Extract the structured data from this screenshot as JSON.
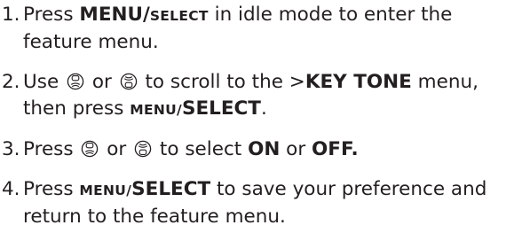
{
  "steps": [
    {
      "number": "1.",
      "t1": "Press ",
      "menu_bold": "MENU/",
      "select_sc": "SELECT",
      "t2": " in idle mode to enter the feature menu."
    },
    {
      "number": "2.",
      "t1": "Use ",
      "t2": " or ",
      "t3": " to scroll to the >",
      "key_tone": "KEY TONE",
      "t4": " menu, then press ",
      "menu_sc": "MENU/",
      "select_bold": "SELECT",
      "t5": "."
    },
    {
      "number": "3.",
      "t1": "Press ",
      "t2": " or ",
      "t3": " to select ",
      "on": "ON",
      "t4": " or ",
      "off": "OFF."
    },
    {
      "number": "4.",
      "t1": "Press ",
      "menu_sc": "MENU/",
      "select_bold": "SELECT",
      "t2": " to save your preference and return to the feature menu."
    }
  ],
  "icons": {
    "up": "navigation-up-key-icon",
    "down": "navigation-down-key-icon"
  }
}
